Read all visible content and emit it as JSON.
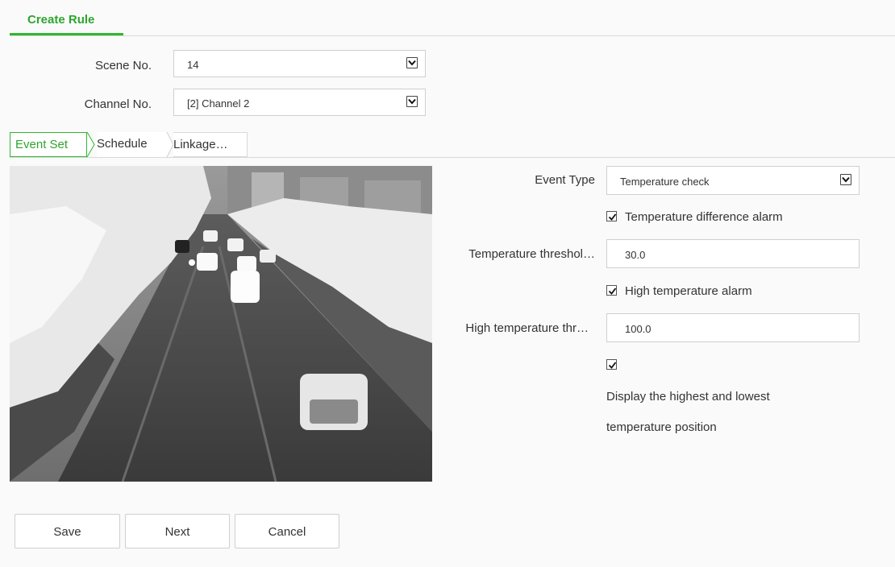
{
  "header": {
    "tab_label": "Create Rule"
  },
  "form": {
    "scene_label": "Scene No.",
    "scene_value": "14",
    "channel_label": "Channel No.",
    "channel_value": "[2] Channel 2"
  },
  "steps": [
    {
      "label": "Event Set"
    },
    {
      "label": "Schedule"
    },
    {
      "label": "Linkage…"
    }
  ],
  "event": {
    "type_label": "Event Type",
    "type_value": "Temperature check",
    "temp_diff_alarm_label": "Temperature difference alarm",
    "temp_diff_alarm_checked": true,
    "temp_threshold_label": "Temperature threshol…",
    "temp_threshold_value": "30.0",
    "high_temp_alarm_label": "High temperature alarm",
    "high_temp_alarm_checked": true,
    "high_temp_threshold_label": "High temperature thr…",
    "high_temp_threshold_value": "100.0",
    "display_position_checked": true,
    "display_position_label_line1": "Display the highest and lowest",
    "display_position_label_line2": "temperature position"
  },
  "buttons": {
    "save": "Save",
    "next": "Next",
    "cancel": "Cancel"
  },
  "colors": {
    "accent": "#2eb82e"
  }
}
